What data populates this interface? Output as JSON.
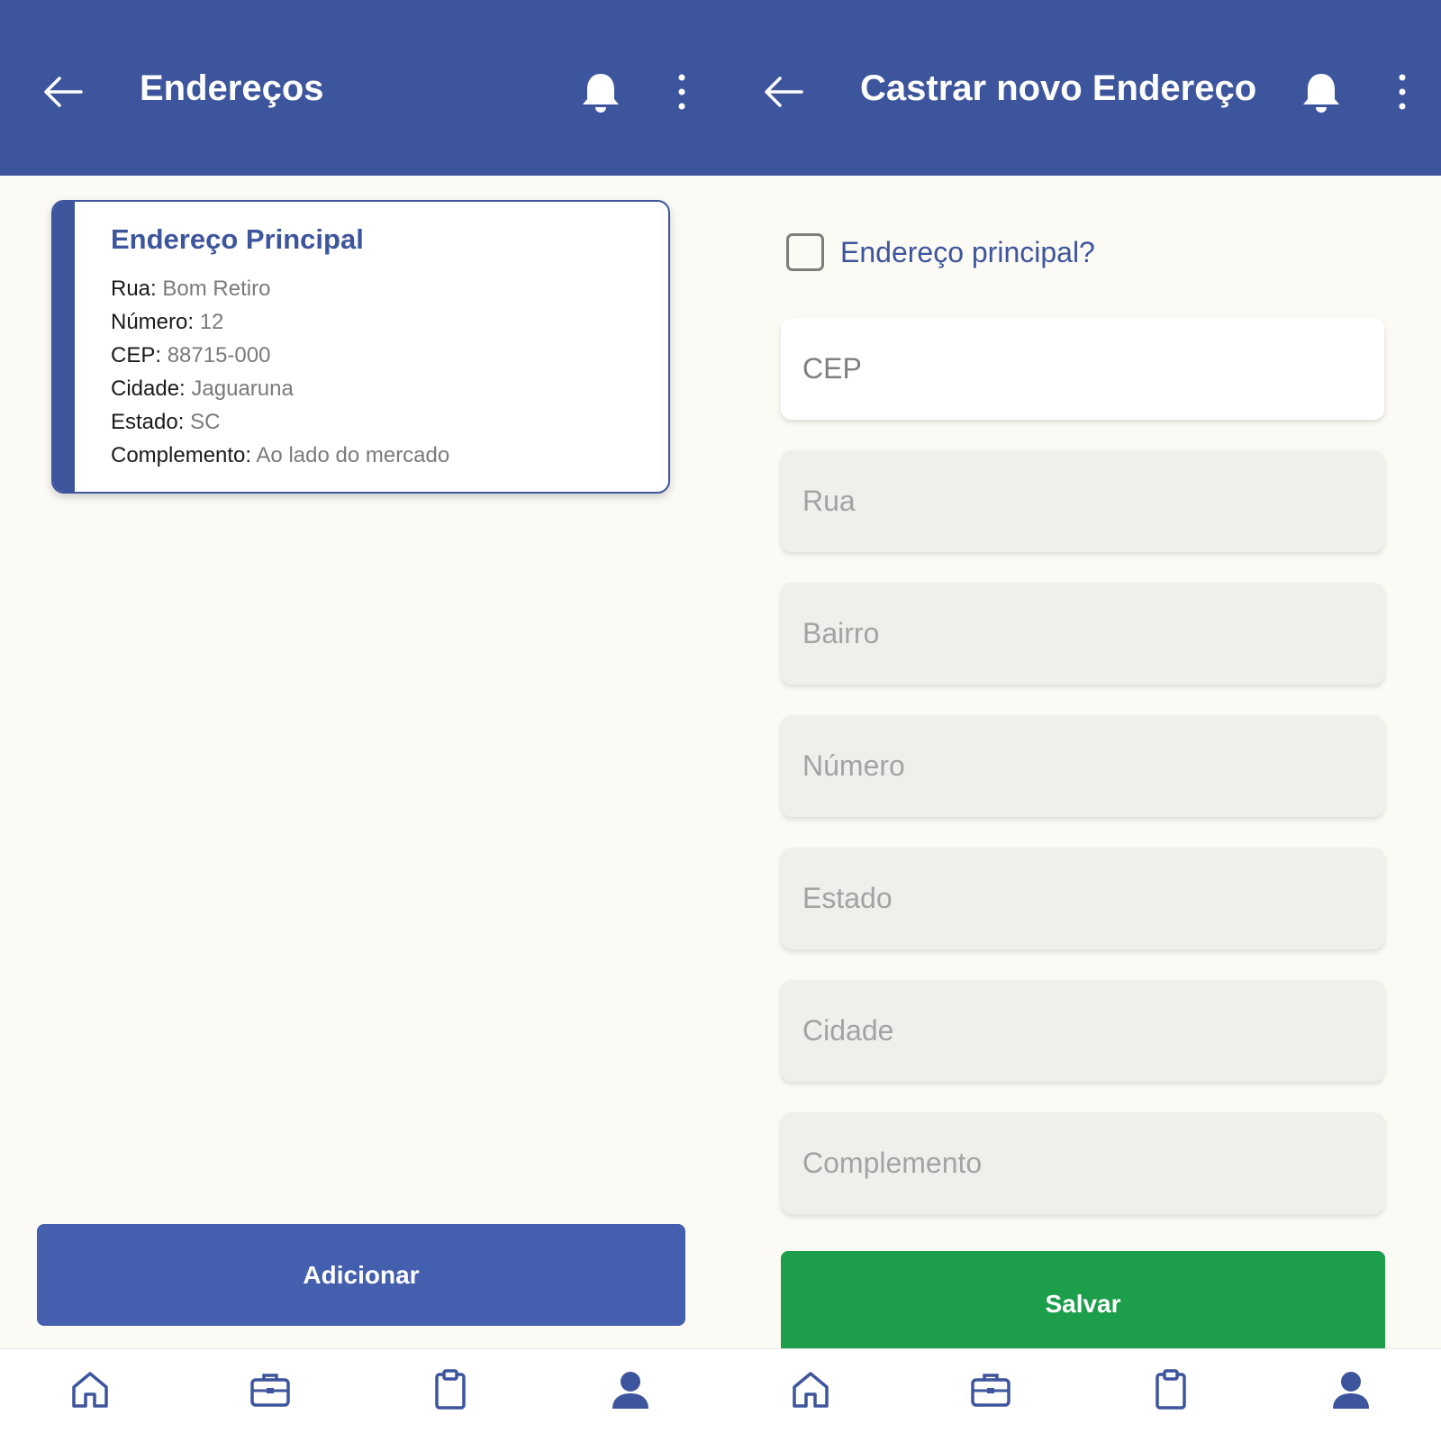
{
  "left_screen": {
    "appbar": {
      "title": "Endereços",
      "back_icon": "arrow-left-icon",
      "bell_icon": "bell-icon",
      "more_icon": "more-vertical-icon"
    },
    "address_card": {
      "title": "Endereço Principal",
      "fields": [
        {
          "label": "Rua:",
          "value": "Bom Retiro"
        },
        {
          "label": "Número:",
          "value": "12"
        },
        {
          "label": "CEP:",
          "value": "88715-000"
        },
        {
          "label": "Cidade:",
          "value": "Jaguaruna"
        },
        {
          "label": "Estado:",
          "value": "SC"
        },
        {
          "label": "Complemento:",
          "value": "Ao lado do mercado"
        }
      ]
    },
    "add_button_label": "Adicionar"
  },
  "right_screen": {
    "appbar": {
      "title": "Castrar novo Endereço",
      "back_icon": "arrow-left-icon",
      "bell_icon": "bell-icon",
      "more_icon": "more-vertical-icon"
    },
    "principal_checkbox": {
      "label": "Endereço principal?",
      "checked": false
    },
    "form": {
      "cep_placeholder": "CEP",
      "rua_placeholder": "Rua",
      "bairro_placeholder": "Bairro",
      "numero_placeholder": "Número",
      "estado_placeholder": "Estado",
      "cidade_placeholder": "Cidade",
      "complemento_placeholder": "Complemento"
    },
    "save_button_label": "Salvar"
  },
  "bottom_nav": {
    "items": [
      "home-icon",
      "briefcase-icon",
      "clipboard-icon",
      "user-icon"
    ]
  },
  "colors": {
    "primary": "#3d559c",
    "add_button": "#435fae",
    "save_button": "#1c9e4b",
    "background": "#fcfaf5",
    "input_disabled": "#f0efec"
  }
}
